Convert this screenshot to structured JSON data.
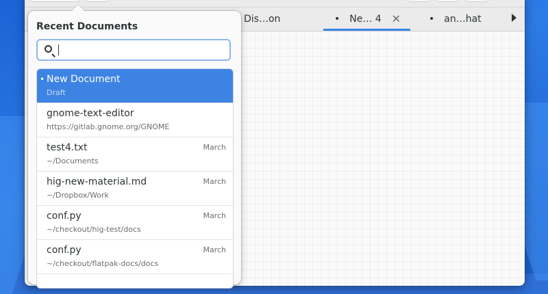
{
  "tabs": [
    {
      "label": "Dis…on",
      "active": false,
      "modified": false
    },
    {
      "label": "Ne… 4",
      "active": true,
      "modified": true
    },
    {
      "label": "an…hat",
      "active": false,
      "modified": true
    }
  ],
  "popover": {
    "title": "Recent Documents",
    "search_value": "",
    "search_placeholder": ""
  },
  "recent": [
    {
      "name": "New Document",
      "path": "Draft",
      "date": "",
      "selected": true,
      "modified": true
    },
    {
      "name": "gnome-text-editor",
      "path": "https://gitlab.gnome.org/GNOME",
      "date": "",
      "selected": false,
      "modified": false
    },
    {
      "name": "test4.txt",
      "path": "~/Documents",
      "date": "March",
      "selected": false,
      "modified": false
    },
    {
      "name": "hig-new-material.md",
      "path": "~/Dropbox/Work",
      "date": "March",
      "selected": false,
      "modified": false
    },
    {
      "name": "conf.py",
      "path": "~/checkout/hig-test/docs",
      "date": "March",
      "selected": false,
      "modified": false
    },
    {
      "name": "conf.py",
      "path": "~/checkout/flatpak-docs/docs",
      "date": "March",
      "selected": false,
      "modified": false
    }
  ],
  "icons": {
    "search": "search-icon",
    "close": "close-icon",
    "tabs_overflow": "chevron-right-icon"
  },
  "colors": {
    "accent": "#3584e4",
    "selection": "#3d83e3",
    "desktop": "#2d7be6"
  }
}
